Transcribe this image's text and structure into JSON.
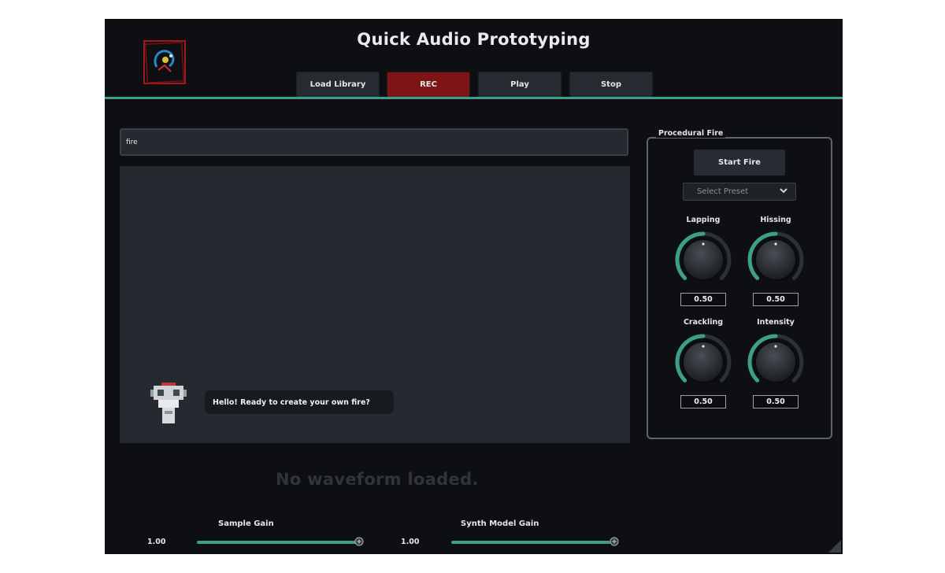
{
  "app": {
    "title": "Quick Audio Prototyping",
    "accent_color": "#3c9f89",
    "rec_color": "#7e1416"
  },
  "toolbar": {
    "load_library": "Load Library",
    "rec": "REC",
    "play": "Play",
    "stop": "Stop"
  },
  "search": {
    "value": "fire"
  },
  "assistant": {
    "message": "Hello! Ready to create your own fire?"
  },
  "panel": {
    "title": "Procedural Fire",
    "start_button": "Start Fire",
    "preset_placeholder": "Select Preset",
    "knobs": [
      {
        "label": "Lapping",
        "value": "0.50",
        "level": 0.5
      },
      {
        "label": "Hissing",
        "value": "0.50",
        "level": 0.5
      },
      {
        "label": "Crackling",
        "value": "0.50",
        "level": 0.5
      },
      {
        "label": "Intensity",
        "value": "0.50",
        "level": 0.5
      }
    ]
  },
  "waveform": {
    "empty_text": "No waveform loaded."
  },
  "sliders": {
    "sample_gain": {
      "label": "Sample Gain",
      "value": "1.00"
    },
    "synth_gain": {
      "label": "Synth Model Gain",
      "value": "1.00"
    }
  }
}
